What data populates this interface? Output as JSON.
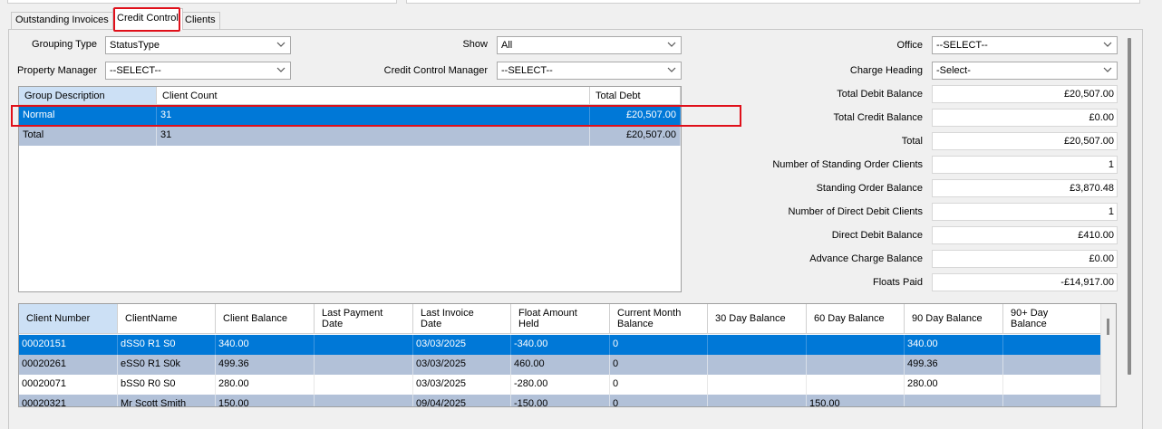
{
  "tabs": [
    {
      "label": "Outstanding Invoices"
    },
    {
      "label": "Credit Control"
    },
    {
      "label": "Clients"
    }
  ],
  "filters": {
    "grouping_type_label": "Grouping Type",
    "grouping_type_value": "StatusType",
    "property_manager_label": "Property Manager",
    "property_manager_value": "--SELECT--",
    "show_label": "Show",
    "show_value": "All",
    "credit_control_manager_label": "Credit Control Manager",
    "credit_control_manager_value": "--SELECT--",
    "office_label": "Office",
    "office_value": "--SELECT--",
    "charge_heading_label": "Charge Heading",
    "charge_heading_value": "-Select-"
  },
  "summary_grid": {
    "columns": [
      "Group Description",
      "Client Count",
      "Total Debt"
    ],
    "rows": [
      [
        "Normal",
        "31",
        "£20,507.00"
      ],
      [
        "Total",
        "31",
        "£20,507.00"
      ]
    ]
  },
  "balances": [
    {
      "label": "Total Debit Balance",
      "value": "£20,507.00"
    },
    {
      "label": "Total Credit Balance",
      "value": "£0.00"
    },
    {
      "label": "Total",
      "value": "£20,507.00"
    },
    {
      "label": "Number of Standing Order Clients",
      "value": "1"
    },
    {
      "label": "Standing Order Balance",
      "value": "£3,870.48"
    },
    {
      "label": "Number of Direct Debit Clients",
      "value": "1"
    },
    {
      "label": "Direct Debit Balance",
      "value": "£410.00"
    },
    {
      "label": "Advance Charge Balance",
      "value": "£0.00"
    },
    {
      "label": "Floats Paid",
      "value": "-£14,917.00"
    }
  ],
  "client_grid": {
    "columns": [
      {
        "l1": "Client Number",
        "l2": ""
      },
      {
        "l1": "ClientName",
        "l2": ""
      },
      {
        "l1": "Client Balance",
        "l2": ""
      },
      {
        "l1": "Last Payment",
        "l2": "Date"
      },
      {
        "l1": "Last Invoice",
        "l2": "Date"
      },
      {
        "l1": "Float Amount",
        "l2": "Held"
      },
      {
        "l1": "Current Month",
        "l2": "Balance"
      },
      {
        "l1": "30 Day Balance",
        "l2": ""
      },
      {
        "l1": "60 Day Balance",
        "l2": ""
      },
      {
        "l1": "90 Day Balance",
        "l2": ""
      },
      {
        "l1": "90+ Day",
        "l2": "Balance"
      }
    ],
    "rows": [
      [
        "00020151",
        "dSS0 R1 S0",
        "340.00",
        "",
        "03/03/2025",
        "-340.00",
        "0",
        "",
        "",
        "340.00",
        ""
      ],
      [
        "00020261",
        "eSS0 R1 S0k",
        "499.36",
        "",
        "03/03/2025",
        "460.00",
        "0",
        "",
        "",
        "499.36",
        ""
      ],
      [
        "00020071",
        "bSS0 R0 S0",
        "280.00",
        "",
        "03/03/2025",
        "-280.00",
        "0",
        "",
        "",
        "280.00",
        ""
      ],
      [
        "00020321",
        "Mr Scott Smith",
        "150.00",
        "",
        "09/04/2025",
        "-150.00",
        "0",
        "",
        "150.00",
        "",
        ""
      ]
    ]
  },
  "colors": {
    "selection": "#0078d7",
    "alt_row": "#b2c1d8",
    "highlight": "#e0101a",
    "header_selected": "#cce0f5"
  }
}
